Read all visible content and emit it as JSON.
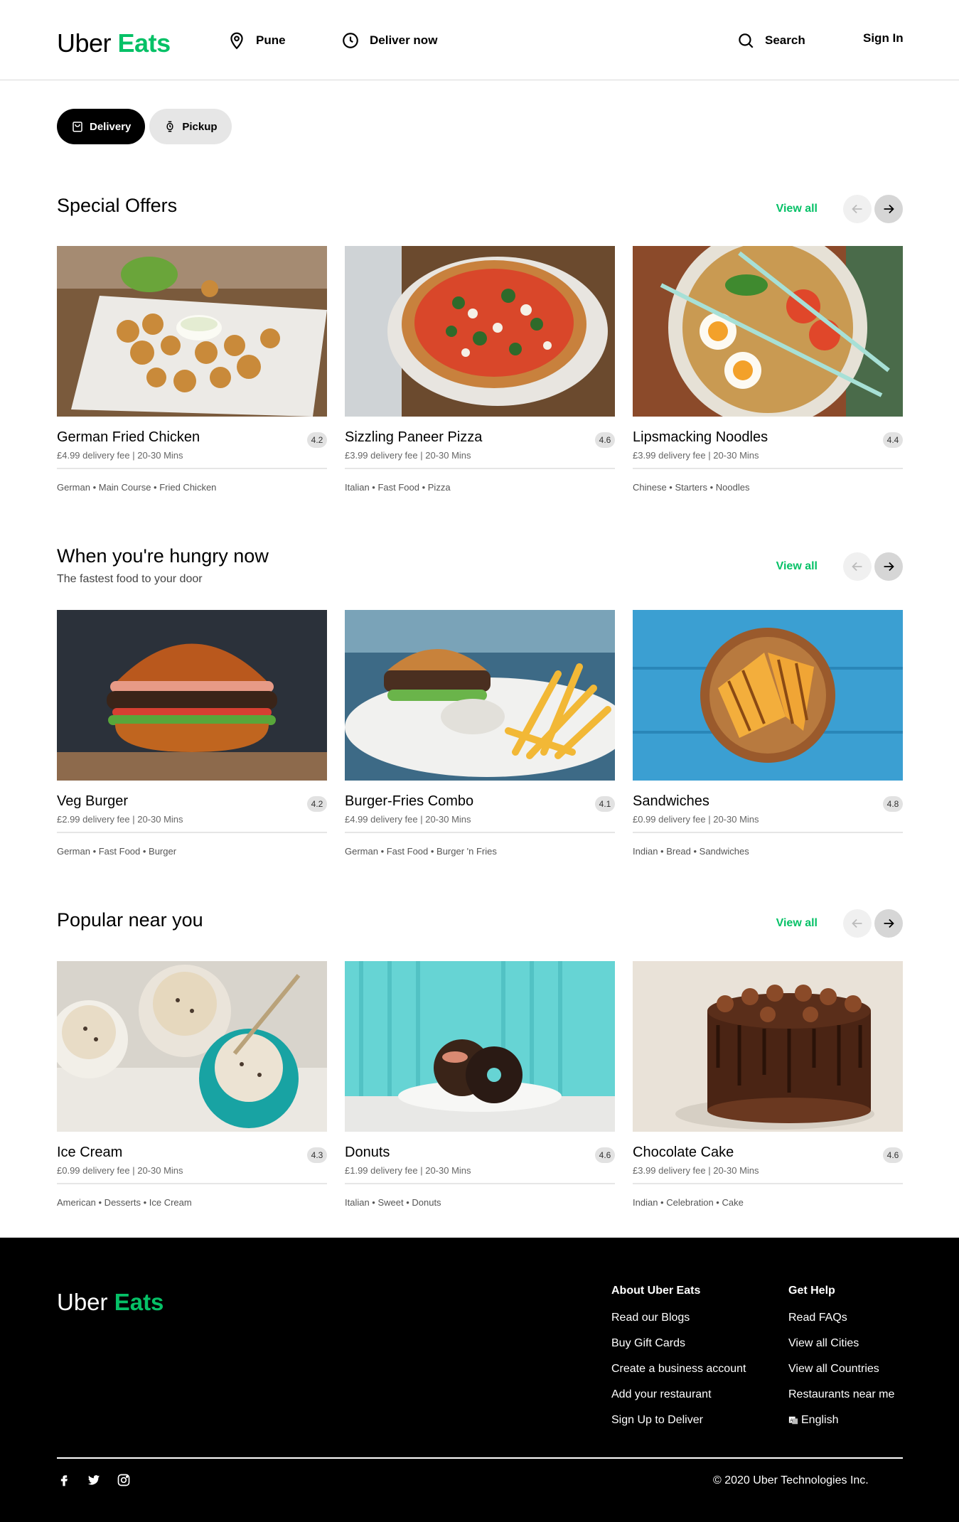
{
  "brand": {
    "uber": "Uber",
    "eats": "Eats",
    "accent": "#06c167"
  },
  "header": {
    "location": "Pune",
    "deliver": "Deliver now",
    "search": "Search",
    "signin": "Sign In"
  },
  "modes": {
    "delivery": "Delivery",
    "pickup": "Pickup"
  },
  "sections": [
    {
      "title": "Special Offers",
      "subtitle": "",
      "view_all": "View all",
      "cards": [
        {
          "name": "German Fried Chicken",
          "rating": "4.2",
          "fee": "£4.99 delivery fee | 20-30 Mins",
          "tags": "German • Main Course • Fried Chicken"
        },
        {
          "name": "Sizzling Paneer Pizza",
          "rating": "4.6",
          "fee": "£3.99 delivery fee | 20-30 Mins",
          "tags": "Italian • Fast Food • Pizza"
        },
        {
          "name": "Lipsmacking Noodles",
          "rating": "4.4",
          "fee": "£3.99 delivery fee | 20-30 Mins",
          "tags": "Chinese • Starters • Noodles"
        }
      ]
    },
    {
      "title": "When you're hungry now",
      "subtitle": "The fastest food to your door",
      "view_all": "View all",
      "cards": [
        {
          "name": "Veg Burger",
          "rating": "4.2",
          "fee": "£2.99 delivery fee | 20-30 Mins",
          "tags": "German • Fast Food • Burger"
        },
        {
          "name": "Burger-Fries Combo",
          "rating": "4.1",
          "fee": "£4.99 delivery fee | 20-30 Mins",
          "tags": "German • Fast Food • Burger 'n Fries"
        },
        {
          "name": "Sandwiches",
          "rating": "4.8",
          "fee": "£0.99 delivery fee | 20-30 Mins",
          "tags": "Indian • Bread • Sandwiches"
        }
      ]
    },
    {
      "title": "Popular near you",
      "subtitle": "",
      "view_all": "View all",
      "cards": [
        {
          "name": "Ice Cream",
          "rating": "4.3",
          "fee": "£0.99 delivery fee | 20-30 Mins",
          "tags": "American • Desserts • Ice Cream"
        },
        {
          "name": "Donuts",
          "rating": "4.6",
          "fee": "£1.99 delivery fee | 20-30 Mins",
          "tags": "Italian • Sweet • Donuts"
        },
        {
          "name": "Chocolate Cake",
          "rating": "4.6",
          "fee": "£3.99 delivery fee | 20-30 Mins",
          "tags": "Indian • Celebration • Cake"
        }
      ]
    }
  ],
  "footer": {
    "col1": {
      "heading": "About Uber Eats",
      "links": [
        "Read our Blogs",
        "Buy Gift Cards",
        "Create a business account",
        "Add your restaurant",
        "Sign Up to Deliver"
      ]
    },
    "col2": {
      "heading": "Get Help",
      "links": [
        "Read FAQs",
        "View all Cities",
        "View all Countries",
        "Restaurants near me",
        "English"
      ]
    },
    "copyright": "© 2020 Uber Technologies Inc.",
    "social_icons": [
      "facebook-icon",
      "twitter-icon",
      "instagram-icon"
    ]
  }
}
